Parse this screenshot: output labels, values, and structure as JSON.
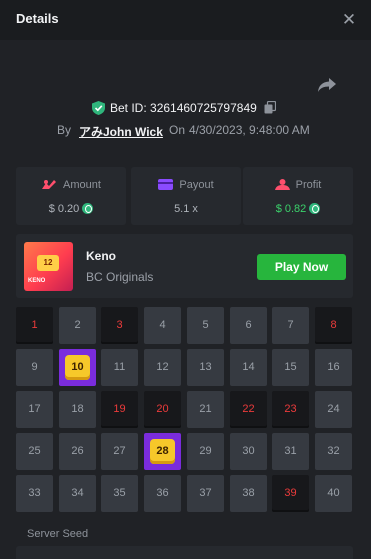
{
  "header": {
    "title": "Details",
    "close_icon": "close-icon"
  },
  "bet": {
    "id_label": "Bet ID: 3261460725797849",
    "by_label": "By",
    "user": "アみJohn Wick",
    "on_label": "On",
    "datetime": "4/30/2023, 9:48:00 AM",
    "verified_color": "#2fb67c"
  },
  "stats": [
    {
      "label": "Amount",
      "value": "$ 0.20",
      "icon": "amount-icon",
      "value_color": "#aeb3ba"
    },
    {
      "label": "Payout",
      "value": "5.1 x",
      "icon": "payout-icon",
      "value_color": "#aeb3ba"
    },
    {
      "label": "Profit",
      "value": "$ 0.82",
      "icon": "profit-icon",
      "value_color": "#3bd16b"
    }
  ],
  "game": {
    "name": "Keno",
    "provider": "BC Originals",
    "thumb_label": "KENO",
    "thumb_number": "12",
    "play_label": "Play Now",
    "play_color": "#27b53d"
  },
  "keno": {
    "numbers": [
      "1",
      "2",
      "3",
      "4",
      "5",
      "6",
      "7",
      "8",
      "9",
      "10",
      "11",
      "12",
      "13",
      "14",
      "15",
      "16",
      "17",
      "18",
      "19",
      "20",
      "21",
      "22",
      "23",
      "24",
      "25",
      "26",
      "27",
      "28",
      "29",
      "30",
      "31",
      "32",
      "33",
      "34",
      "35",
      "36",
      "37",
      "38",
      "39",
      "40"
    ],
    "drawn_miss": [
      "1",
      "3",
      "8",
      "19",
      "20",
      "22",
      "23",
      "39"
    ],
    "hits": [
      "10",
      "28"
    ],
    "miss_color": "#ec3b3b",
    "hit_color": "#7a2cdc"
  },
  "seed": {
    "label": "Server Seed"
  }
}
